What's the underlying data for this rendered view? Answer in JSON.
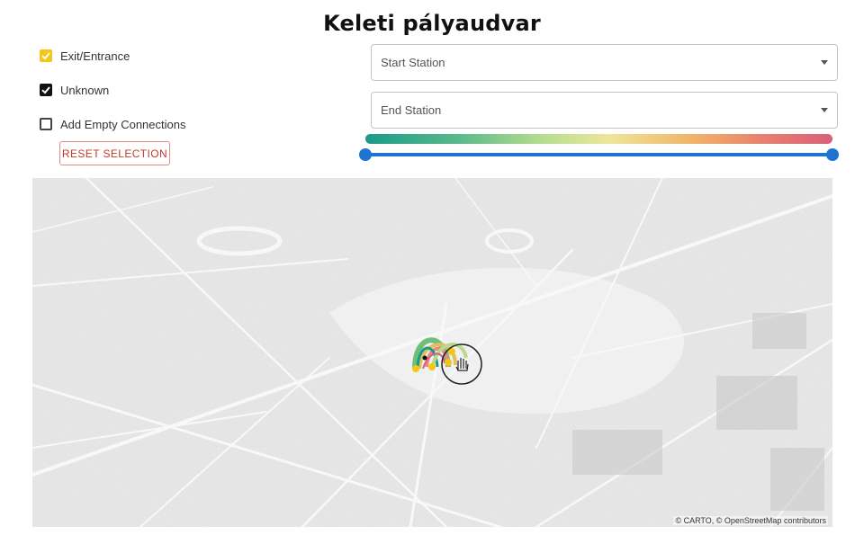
{
  "header": {
    "title": "Keleti pályaudvar"
  },
  "filters": {
    "exit_entrance": {
      "label": "Exit/Entrance",
      "checked": true,
      "color": "#f5c518"
    },
    "unknown": {
      "label": "Unknown",
      "checked": true,
      "color": "#111111"
    },
    "empty_connections": {
      "label": "Add Empty Connections",
      "checked": false
    },
    "reset_label": "RESET SELECTION"
  },
  "start_station": {
    "placeholder": "Start Station",
    "icon": "chevron-down-icon"
  },
  "end_station": {
    "placeholder": "End Station",
    "icon": "chevron-down-icon"
  },
  "range_slider": {
    "low": 0,
    "high": 1,
    "gradient_colors": [
      "#1a9a8b",
      "#5bb98a",
      "#b7dd8f",
      "#ede69a",
      "#f1b46a",
      "#e8806f",
      "#d95f79"
    ],
    "track_color": "#1e74d0"
  },
  "map": {
    "attribution_carto": "© CARTO, ©",
    "attribution_osm": "OpenStreetMap",
    "attribution_contributors": "contributors",
    "cursor_icon": "grab-hand-icon"
  }
}
